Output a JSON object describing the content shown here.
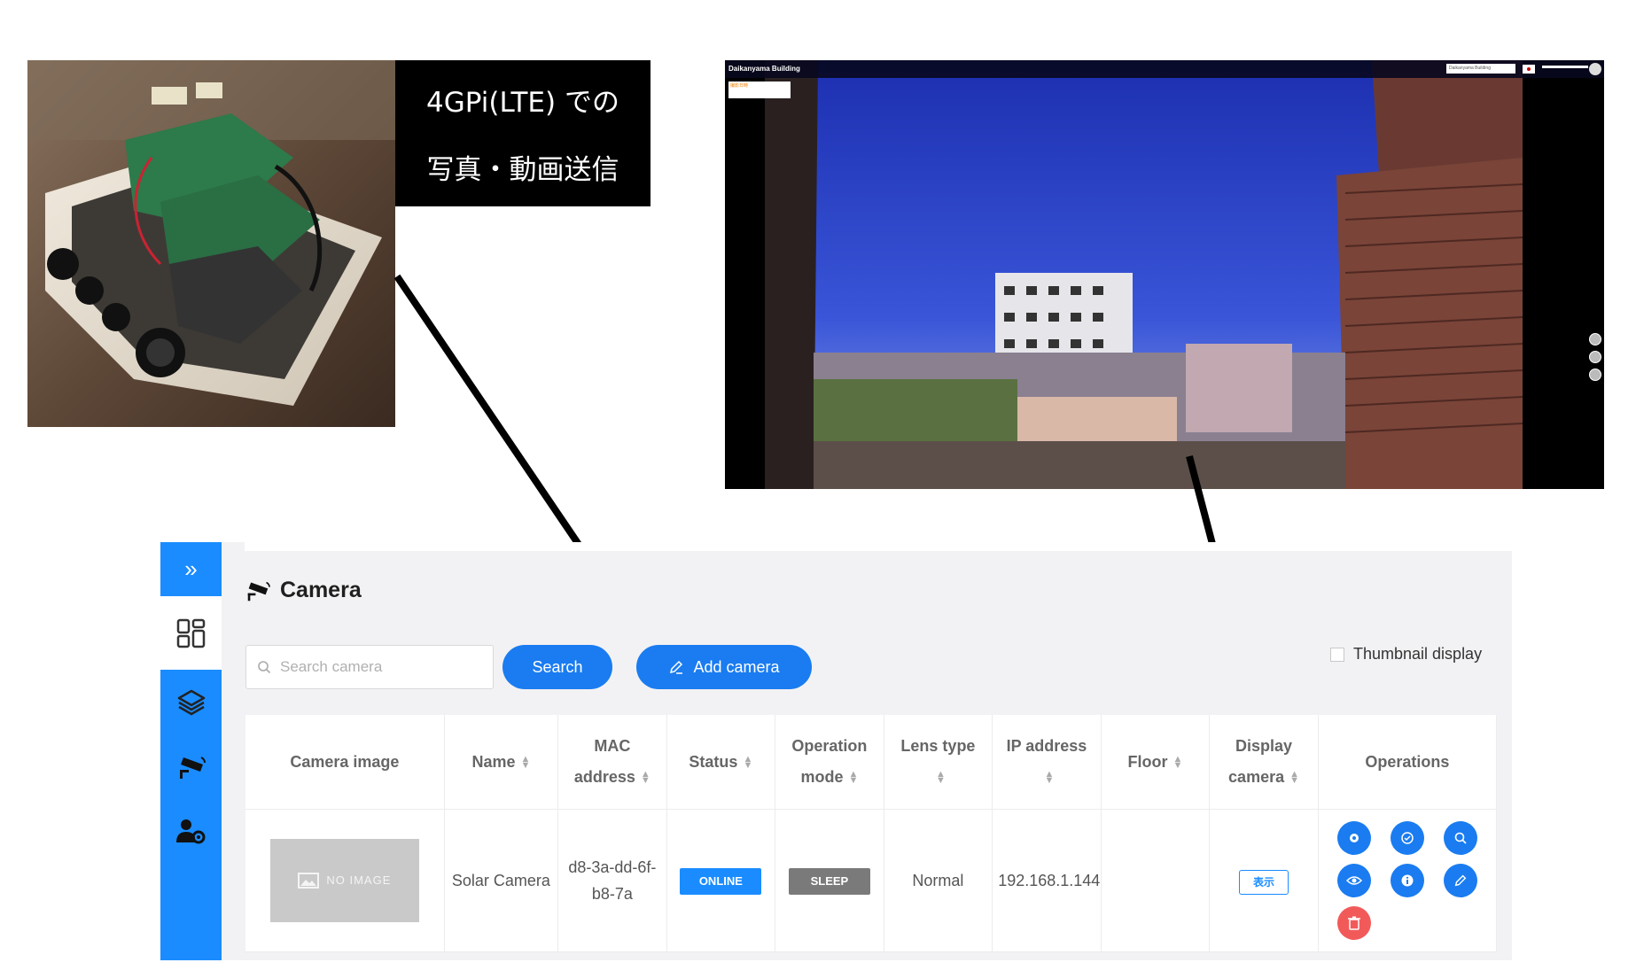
{
  "device_photo": {
    "caption_line1": "4GPi(LTE) での",
    "caption_line2": "写真・動画送信"
  },
  "live_view": {
    "building_name": "Daikanyama Building",
    "building_select": "Daikanyama Building",
    "overlay_label": "撮影日時"
  },
  "app": {
    "sidebar": {
      "items": [
        {
          "name": "collapse",
          "icon": "double-chevron-right-icon",
          "label": "»"
        },
        {
          "name": "dashboard",
          "icon": "dashboard-icon"
        },
        {
          "name": "layers",
          "icon": "layers-icon"
        },
        {
          "name": "camera",
          "icon": "security-camera-icon"
        },
        {
          "name": "user-settings",
          "icon": "user-gear-icon"
        }
      ]
    },
    "page_title": "Camera",
    "search": {
      "placeholder": "Search camera",
      "value": "",
      "button_label": "Search"
    },
    "add_camera_label": "Add camera",
    "thumbnail_toggle": {
      "label": "Thumbnail display",
      "checked": false
    },
    "table": {
      "headers": {
        "camera_image": "Camera image",
        "name": "Name",
        "mac_address": "MAC address",
        "status": "Status",
        "operation_mode": "Operation mode",
        "lens_type": "Lens type",
        "ip_address": "IP address",
        "floor": "Floor",
        "display_camera": "Display camera",
        "operations": "Operations"
      },
      "rows": [
        {
          "camera_image": "NO IMAGE",
          "name": "Solar Camera",
          "mac_address": "d8-3a-dd-6f-b8-7a",
          "status": "ONLINE",
          "operation_mode": "SLEEP",
          "lens_type": "Normal",
          "ip_address": "192.168.1.144",
          "floor": "",
          "display_camera": "表示",
          "operations": [
            "settings-icon",
            "check-icon",
            "search-icon",
            "view-icon",
            "info-icon",
            "edit-icon",
            "delete-icon"
          ]
        }
      ]
    },
    "colors": {
      "primary": "#1a8cff",
      "button": "#1a7cf0",
      "sleep": "#7a7a7a",
      "delete": "#f25a5a"
    }
  }
}
